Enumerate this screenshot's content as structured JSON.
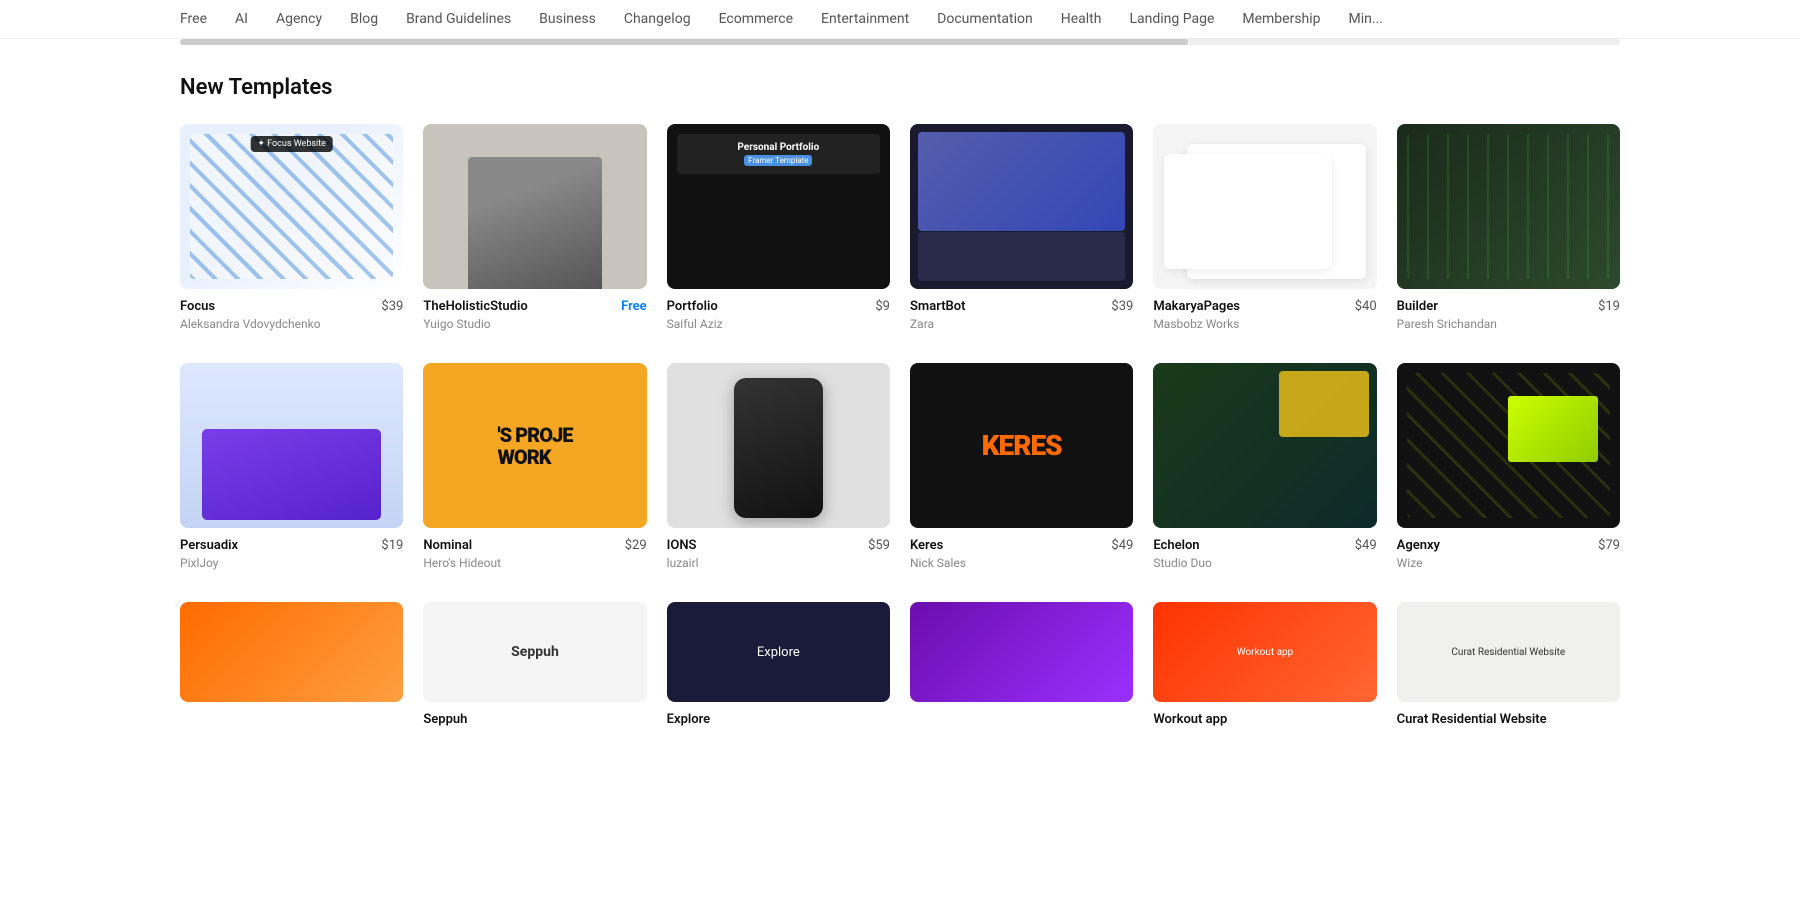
{
  "nav": {
    "items": [
      {
        "label": "Free",
        "id": "free"
      },
      {
        "label": "AI",
        "id": "ai"
      },
      {
        "label": "Agency",
        "id": "agency"
      },
      {
        "label": "Blog",
        "id": "blog"
      },
      {
        "label": "Brand Guidelines",
        "id": "brand-guidelines"
      },
      {
        "label": "Business",
        "id": "business"
      },
      {
        "label": "Changelog",
        "id": "changelog"
      },
      {
        "label": "Ecommerce",
        "id": "ecommerce"
      },
      {
        "label": "Entertainment",
        "id": "entertainment"
      },
      {
        "label": "Documentation",
        "id": "documentation"
      },
      {
        "label": "Health",
        "id": "health"
      },
      {
        "label": "Landing Page",
        "id": "landing-page"
      },
      {
        "label": "Membership",
        "id": "membership"
      },
      {
        "label": "Min...",
        "id": "min"
      }
    ]
  },
  "section": {
    "title": "New Templates"
  },
  "row1": [
    {
      "id": "focus",
      "name": "Focus",
      "author": "Aleksandra Vdovydchenko",
      "price": "$39",
      "price_type": "paid",
      "badge": "✦ Focus Website"
    },
    {
      "id": "theholisticstudio",
      "name": "TheHolisticStudio",
      "author": "Yuigo Studio",
      "price": "Free",
      "price_type": "free"
    },
    {
      "id": "portfolio",
      "name": "Portfolio",
      "author": "Saiful Aziz",
      "price": "$9",
      "price_type": "paid"
    },
    {
      "id": "smartbot",
      "name": "SmartBot",
      "author": "Zara",
      "price": "$39",
      "price_type": "paid"
    },
    {
      "id": "makaryapages",
      "name": "MakaryaPages",
      "author": "Masbobz Works",
      "price": "$40",
      "price_type": "paid"
    },
    {
      "id": "builder",
      "name": "Builder",
      "author": "Paresh Srichandan",
      "price": "$19",
      "price_type": "paid"
    }
  ],
  "row2": [
    {
      "id": "persuadix",
      "name": "Persuadix",
      "author": "PixlJoy",
      "price": "$19",
      "price_type": "paid"
    },
    {
      "id": "nominal",
      "name": "Nominal",
      "author": "Hero's Hideout",
      "price": "$29",
      "price_type": "paid"
    },
    {
      "id": "ions",
      "name": "IONS",
      "author": "luzairl",
      "price": "$59",
      "price_type": "paid"
    },
    {
      "id": "keres",
      "name": "Keres",
      "author": "Nick Sales",
      "price": "$49",
      "price_type": "paid"
    },
    {
      "id": "echelon",
      "name": "Echelon",
      "author": "Studio Duo",
      "price": "$49",
      "price_type": "paid"
    },
    {
      "id": "agenxy",
      "name": "Agenxy",
      "author": "Wize",
      "price": "$79",
      "price_type": "paid"
    }
  ],
  "row3": [
    {
      "id": "orange",
      "name": "",
      "author": "",
      "price": ""
    },
    {
      "id": "seppuh",
      "name": "Seppuh",
      "author": "",
      "price": ""
    },
    {
      "id": "explore",
      "name": "Explore",
      "author": "",
      "price": ""
    },
    {
      "id": "purple",
      "name": "",
      "author": "",
      "price": ""
    },
    {
      "id": "workout",
      "name": "Workout app",
      "author": "",
      "price": ""
    },
    {
      "id": "curat",
      "name": "Curat Residential Website",
      "author": "",
      "price": ""
    }
  ]
}
